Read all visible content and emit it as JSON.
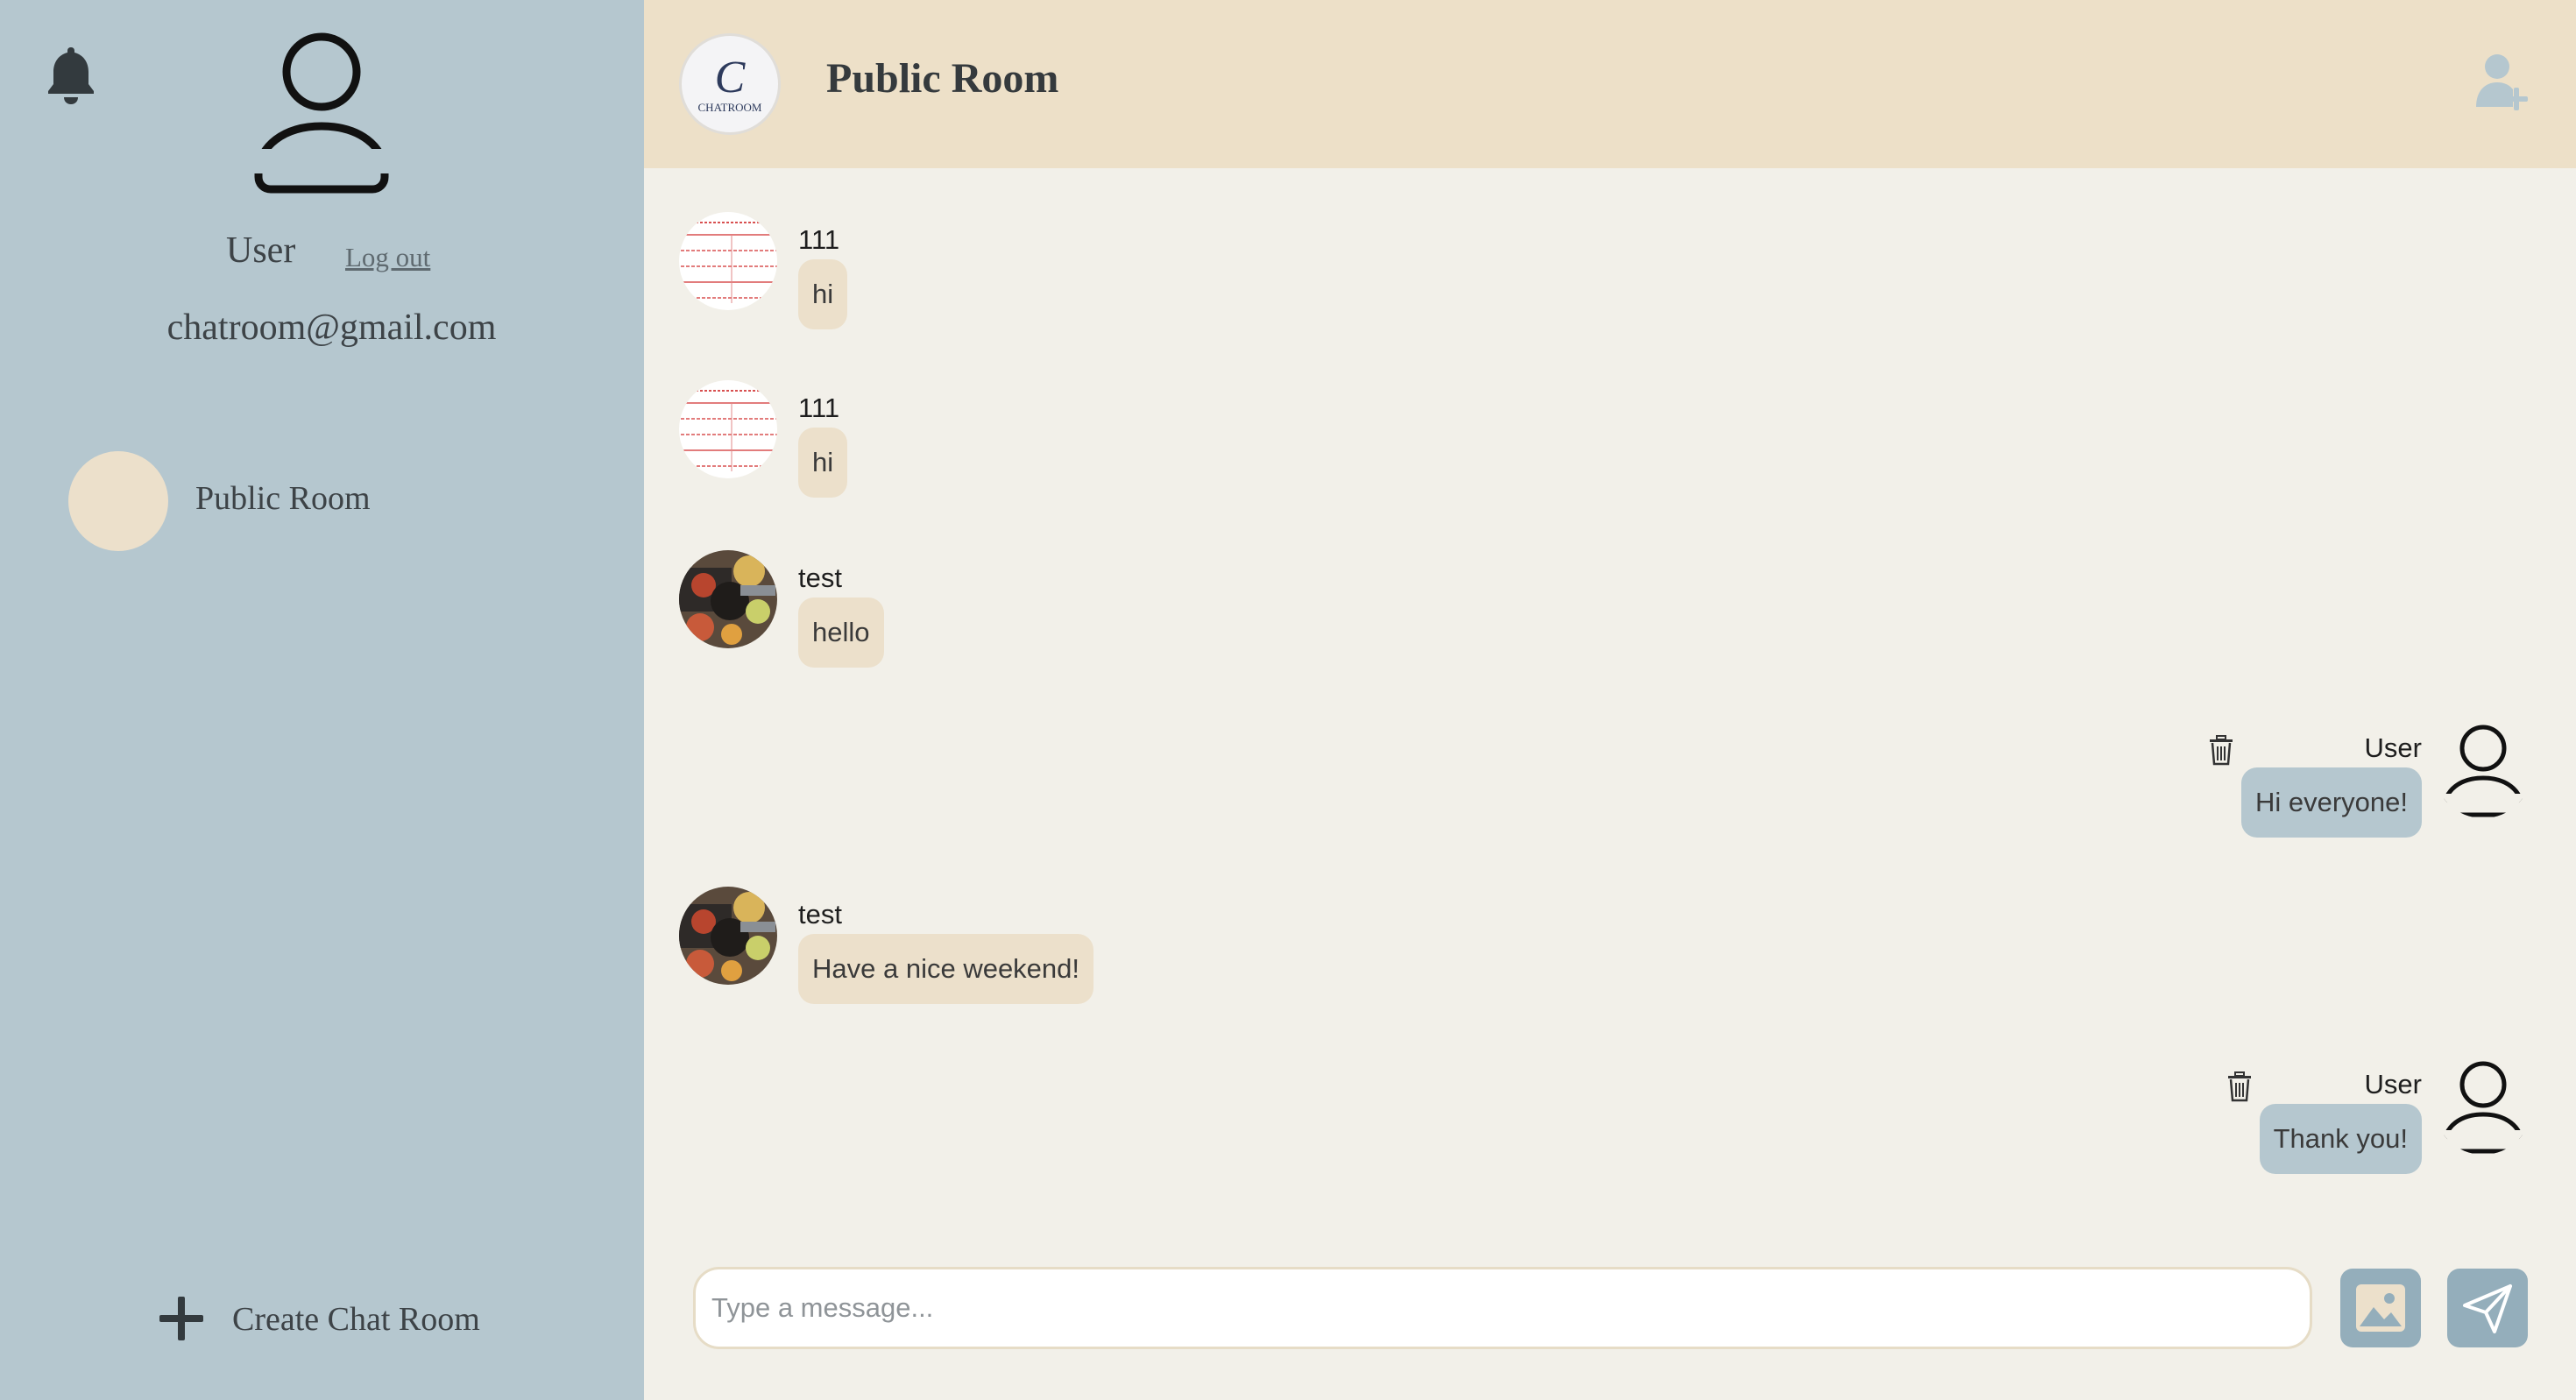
{
  "sidebar": {
    "username": "User",
    "logout_label": "Log out",
    "email": "chatroom@gmail.com",
    "rooms": [
      {
        "label": "Public Room"
      }
    ],
    "create_room_label": "Create Chat Room"
  },
  "header": {
    "room_title": "Public Room",
    "logo_text": "CHATROOM",
    "logo_letter": "C"
  },
  "messages": [
    {
      "sender": "111",
      "text": "hi",
      "side": "left"
    },
    {
      "sender": "111",
      "text": "hi",
      "side": "left"
    },
    {
      "sender": "test",
      "text": "hello",
      "side": "left"
    },
    {
      "sender": "User",
      "text": "Hi everyone!",
      "side": "right"
    },
    {
      "sender": "test",
      "text": "Have a nice weekend!",
      "side": "left"
    },
    {
      "sender": "User",
      "text": "Thank you!",
      "side": "right"
    }
  ],
  "composer": {
    "placeholder": "Type a message..."
  },
  "colors": {
    "sidebar_bg": "#b5c7cf",
    "header_bg": "#ede0c8",
    "chat_bg": "#f2f0e9",
    "incoming_bubble": "#ece0cb",
    "outgoing_bubble": "#b5c7cf",
    "button_bg": "#94aebb"
  }
}
